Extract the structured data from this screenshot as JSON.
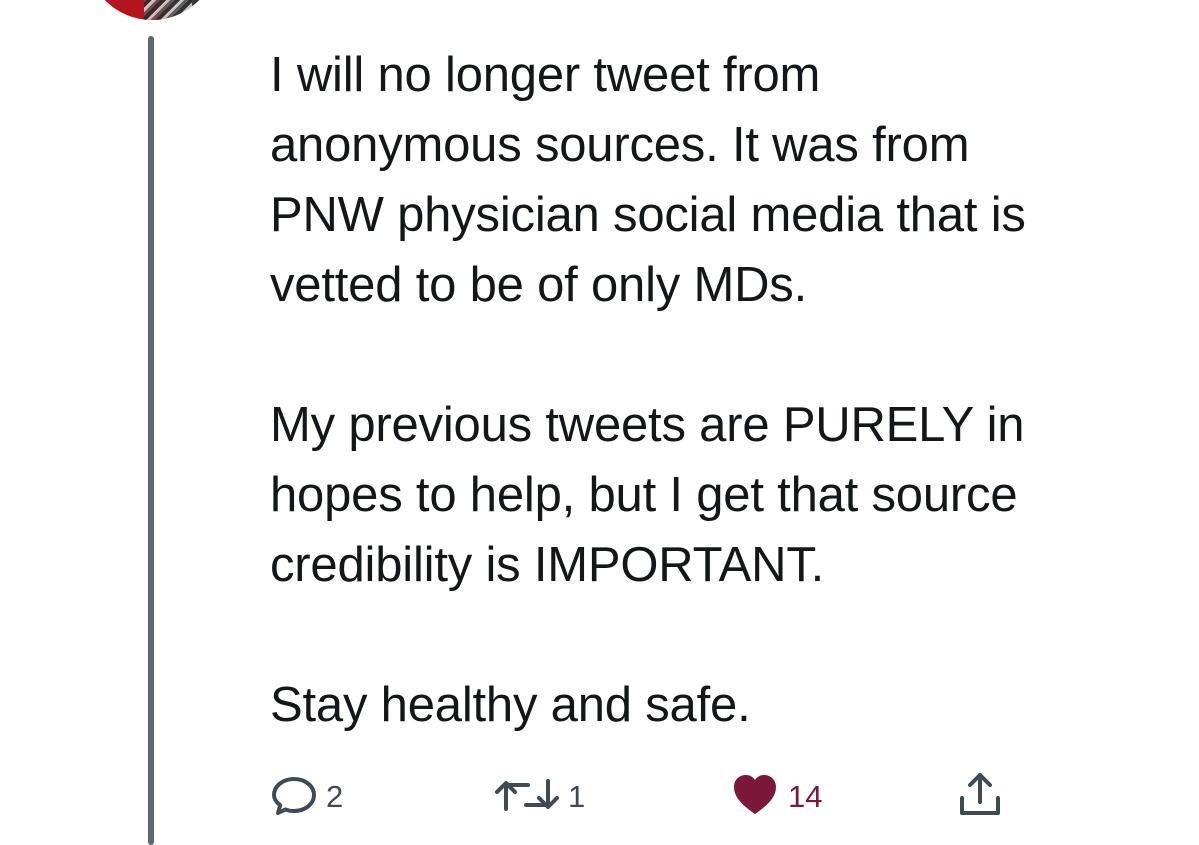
{
  "tweet": {
    "paragraphs": [
      {
        "lines": [
          "I will no longer tweet from",
          "anonymous sources. It was from",
          "PNW physician social media that is",
          "vetted to be of only MDs."
        ]
      },
      {
        "lines": [
          "My previous tweets are PURELY in",
          "hopes to help, but I get that source",
          "credibility is IMPORTANT."
        ]
      },
      {
        "lines": [
          "Stay healthy and safe."
        ]
      }
    ]
  },
  "actions": {
    "reply": {
      "icon": "reply-icon",
      "count": "2"
    },
    "retweet": {
      "icon": "retweet-icon",
      "count": "1"
    },
    "like": {
      "icon": "heart-icon",
      "count": "14",
      "color": "#7b1738",
      "state": "liked"
    },
    "share": {
      "icon": "share-icon"
    }
  },
  "colors": {
    "text": "#14171a",
    "thread_line": "#5d6671",
    "icon": "#3f4a55",
    "like": "#7b1738"
  }
}
